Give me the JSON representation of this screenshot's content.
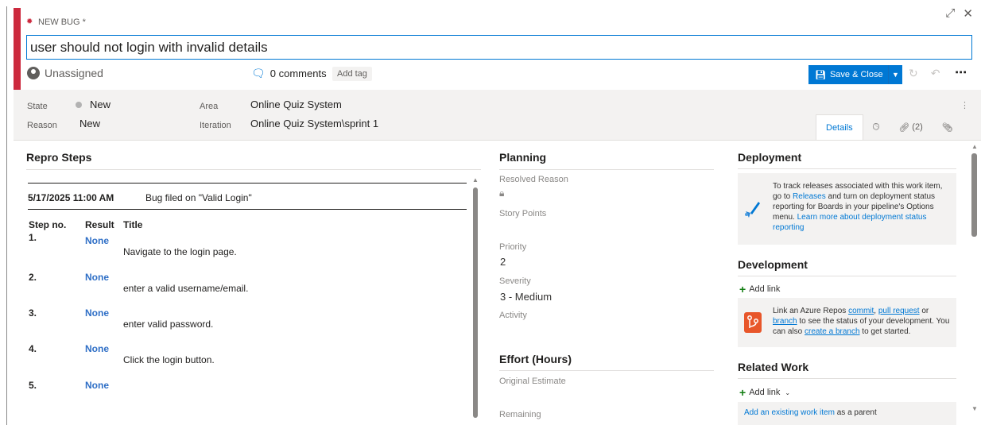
{
  "colors": {
    "accent": "#0078d4",
    "bug_red": "#cc293d",
    "success_green": "#107c10"
  },
  "header": {
    "work_item_type": "NEW BUG *",
    "title": "user should not login with invalid details",
    "assigned": "Unassigned",
    "comments": "0 comments",
    "add_tag": "Add tag",
    "save_close": "Save & Close",
    "more": "⋯"
  },
  "fields": {
    "state_label": "State",
    "state_value": "New",
    "reason_label": "Reason",
    "reason_value": "New",
    "area_label": "Area",
    "area_value": "Online Quiz System",
    "iteration_label": "Iteration",
    "iteration_value": "Online Quiz System\\sprint 1"
  },
  "tabs": {
    "details": "Details",
    "links": "(2)"
  },
  "repro": {
    "title": "Repro Steps",
    "history_date": "5/17/2025 11:00 AM",
    "history_text": "Bug filed on \"Valid Login\"",
    "col_step": "Step no.",
    "col_result": "Result",
    "col_title": "Title",
    "steps": [
      {
        "no": "1.",
        "result": "None",
        "title": "Navigate to the login page."
      },
      {
        "no": "2.",
        "result": "None",
        "title": "enter a valid username/email."
      },
      {
        "no": "3.",
        "result": "None",
        "title": "enter valid password."
      },
      {
        "no": "4.",
        "result": "None",
        "title": "Click the login button."
      },
      {
        "no": "5.",
        "result": "None",
        "title": ""
      }
    ]
  },
  "planning": {
    "title": "Planning",
    "resolved_reason": "Resolved Reason",
    "story_points": "Story Points",
    "priority_label": "Priority",
    "priority_value": "2",
    "severity_label": "Severity",
    "severity_value": "3 - Medium",
    "activity": "Activity",
    "effort_title": "Effort (Hours)",
    "original_estimate": "Original Estimate",
    "remaining": "Remaining"
  },
  "deployment": {
    "title": "Deployment",
    "text_1": "To track releases associated with this work item, go to ",
    "releases_link": "Releases",
    "text_2": " and turn on deployment status reporting for Boards in your pipeline's Options menu. ",
    "learn_link": "Learn more about deployment status reporting"
  },
  "development": {
    "title": "Development",
    "add_link": "Add link",
    "text_1": "Link an Azure Repos ",
    "commit": "commit",
    "sep": ", ",
    "pull_request": "pull request",
    "or": " or ",
    "branch": "branch",
    "text_2": " to see the status of your development. You can also ",
    "create_branch": "create a branch",
    "text_3": " to get started."
  },
  "related": {
    "title": "Related Work",
    "add_link": "Add link",
    "existing_link": "Add an existing work item",
    "existing_text": " as a parent"
  }
}
